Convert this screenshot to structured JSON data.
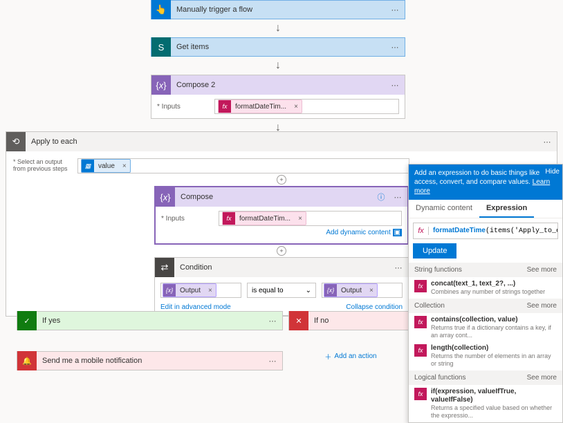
{
  "trigger": {
    "title": "Manually trigger a flow"
  },
  "getItems": {
    "title": "Get items"
  },
  "compose2": {
    "title": "Compose 2",
    "inputsLabel": "* Inputs",
    "token": "formatDateTim..."
  },
  "apply": {
    "title": "Apply to each",
    "selectLabel": "* Select an output from previous steps",
    "valueToken": "value"
  },
  "compose": {
    "title": "Compose",
    "inputsLabel": "* Inputs",
    "token": "formatDateTim...",
    "addDynamic": "Add dynamic content"
  },
  "condition": {
    "title": "Condition",
    "left": "Output",
    "op": "is equal to",
    "right": "Output",
    "editLink": "Edit in advanced mode",
    "collapseLink": "Collapse condition"
  },
  "branches": {
    "yes": "If yes",
    "no": "If no"
  },
  "notification": {
    "title": "Send me a mobile notification"
  },
  "addAction": "Add an action",
  "panel": {
    "banner": "Add an expression to do basic things like access, convert, and compare values.",
    "learnMore": "Learn more",
    "hide": "Hide",
    "tabs": {
      "dynamic": "Dynamic content",
      "expression": "Expression"
    },
    "formula": "formatDateTime(items('Apply_to_each')?['",
    "fnPrefix": "formatDateTime",
    "update": "Update",
    "seeMore": "See more",
    "cats": {
      "string": "String functions",
      "collection": "Collection",
      "logical": "Logical functions"
    },
    "fns": {
      "concat": {
        "sig": "concat(text_1, text_2?, ...)",
        "desc": "Combines any number of strings together"
      },
      "contains": {
        "sig": "contains(collection, value)",
        "desc": "Returns true if a dictionary contains a key, if an array cont..."
      },
      "length": {
        "sig": "length(collection)",
        "desc": "Returns the number of elements in an array or string"
      },
      "if": {
        "sig": "if(expression, valueIfTrue, valueIfFalse)",
        "desc": "Returns a specified value based on whether the expressio..."
      }
    }
  }
}
